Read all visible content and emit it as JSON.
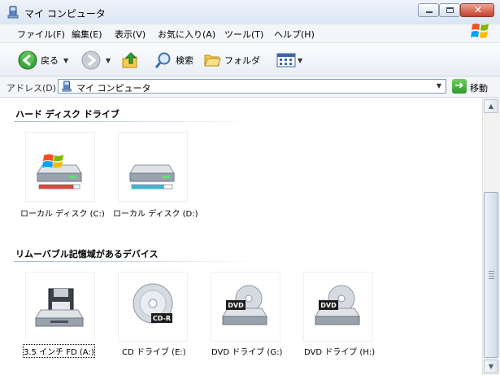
{
  "window": {
    "title": "マイ コンピュータ",
    "minimize_icon": "minimize-icon",
    "maximize_icon": "maximize-icon",
    "close_icon": "close-icon"
  },
  "menu": {
    "items": [
      "ファイル(F)",
      "編集(E)",
      "表示(V)",
      "お気に入り(A)",
      "ツール(T)",
      "ヘルプ(H)"
    ]
  },
  "toolbar": {
    "back_label": "戻る",
    "search_label": "検索",
    "folders_label": "フォルダ"
  },
  "address": {
    "label": "アドレス(D)",
    "value": "マイ コンピュータ",
    "go_label": "移動"
  },
  "groups": [
    {
      "title": "ハード ディスク ドライブ",
      "items": [
        {
          "label": "ローカル ディスク (C:)",
          "icon": "hard-disk-system-icon",
          "usage": 0.85
        },
        {
          "label": "ローカル ディスク (D:)",
          "icon": "hard-disk-icon",
          "usage": 0.8
        }
      ]
    },
    {
      "title": "リムーバブル記憶域があるデバイス",
      "items": [
        {
          "label": "3.5 インチ FD (A:)",
          "icon": "floppy-drive-icon"
        },
        {
          "label": "CD ドライブ (E:)",
          "icon": "cd-drive-icon",
          "badge": "CD-R"
        },
        {
          "label": "DVD ドライブ (G:)",
          "icon": "dvd-drive-icon",
          "badge": "DVD"
        },
        {
          "label": "DVD ドライブ (H:)",
          "icon": "dvd-drive-icon",
          "badge": "DVD"
        }
      ]
    }
  ],
  "colors": {
    "accent": "#2f9a2b",
    "c_bar": "#d6473c",
    "d_bar": "#3fb5c8"
  }
}
